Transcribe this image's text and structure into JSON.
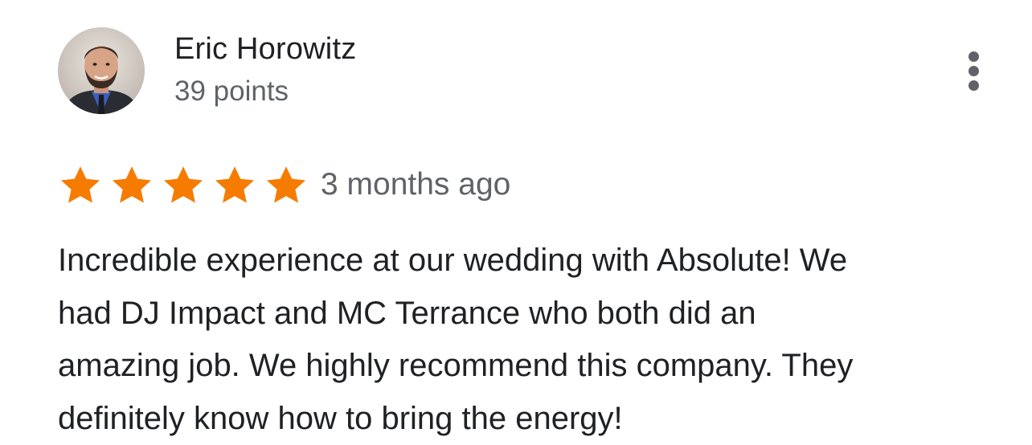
{
  "review": {
    "author": {
      "name": "Eric Horowitz",
      "points": "39 points",
      "avatar_icon": "person-photo"
    },
    "rating": {
      "stars": 5,
      "max_stars": 5,
      "star_color": "#f57c00",
      "star_icon": "star-icon"
    },
    "time": "3 months ago",
    "text": "Incredible experience at our wedding with Absolute! We\nhad DJ Impact and MC Terrance who both did an\namazing job. We highly recommend this company. They\ndefinitely know how to bring the energy!",
    "menu_icon": "more-vert-icon"
  }
}
